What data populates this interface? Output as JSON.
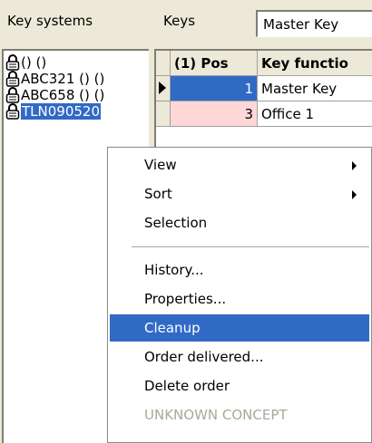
{
  "header": {
    "tab_key_systems": "Key systems",
    "tab_keys": "Keys",
    "dropdown_value": "Master Key"
  },
  "tree": {
    "items": [
      {
        "label": "() ()"
      },
      {
        "label": "ABC321 () ()"
      },
      {
        "label": "ABC658 () ()"
      },
      {
        "label": "TLN090520"
      }
    ]
  },
  "grid": {
    "columns": [
      "(1) Pos",
      "Key functio"
    ],
    "rows": [
      {
        "pos": "1",
        "function": "Master Key"
      },
      {
        "pos": "3",
        "function": "Office 1"
      }
    ]
  },
  "context_menu": {
    "items": [
      {
        "label": "View",
        "submenu": true
      },
      {
        "label": "Sort",
        "submenu": true
      },
      {
        "label": "Selection"
      },
      {
        "label": "History..."
      },
      {
        "label": "Properties..."
      },
      {
        "label": "Cleanup",
        "highlighted": true
      },
      {
        "label": "Order delivered..."
      },
      {
        "label": "Delete order"
      },
      {
        "label": "UNKNOWN CONCEPT",
        "disabled": true
      }
    ]
  },
  "colors": {
    "selection": "#316ac5",
    "row_pink": "#ffd7d7",
    "disabled_text": "#aca899"
  }
}
